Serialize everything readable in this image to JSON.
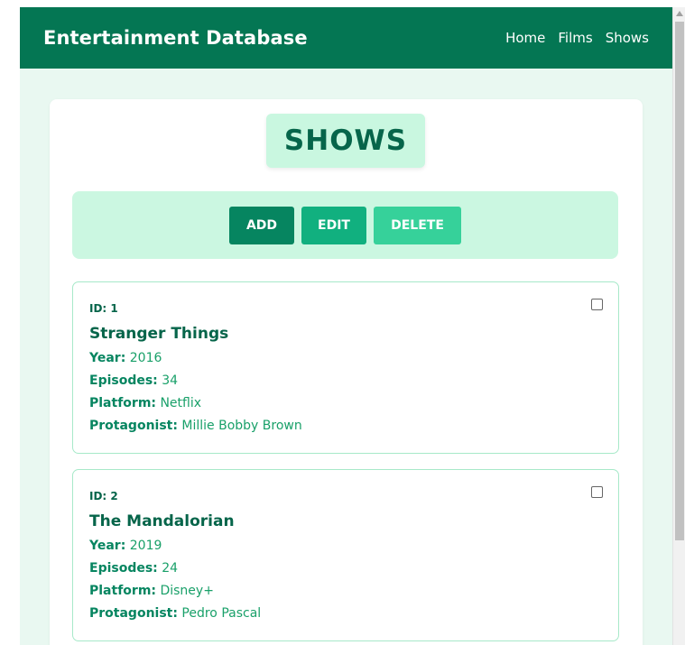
{
  "navbar": {
    "brand": "Entertainment Database",
    "links": [
      "Home",
      "Films",
      "Shows"
    ]
  },
  "page": {
    "title": "SHOWS"
  },
  "toolbar": {
    "add_label": "ADD",
    "edit_label": "EDIT",
    "delete_label": "DELETE"
  },
  "shows": [
    {
      "id_label": "ID: 1",
      "title": "Stranger Things",
      "year_label": "Year:",
      "year": "2016",
      "episodes_label": "Episodes:",
      "episodes": "34",
      "platform_label": "Platform:",
      "platform": "Netflix",
      "protagonist_label": "Protagonist:",
      "protagonist": "Millie Bobby Brown"
    },
    {
      "id_label": "ID: 2",
      "title": "The Mandalorian",
      "year_label": "Year:",
      "year": "2019",
      "episodes_label": "Episodes:",
      "episodes": "24",
      "platform_label": "Platform:",
      "platform": "Disney+",
      "protagonist_label": "Protagonist:",
      "protagonist": "Pedro Pascal"
    }
  ],
  "colors": {
    "navbar": "#047653",
    "background": "#e9f8f1",
    "title_box": "#c9f7e0",
    "add_button": "#068560",
    "edit_button": "#11b07f",
    "delete_button": "#36d19a"
  }
}
